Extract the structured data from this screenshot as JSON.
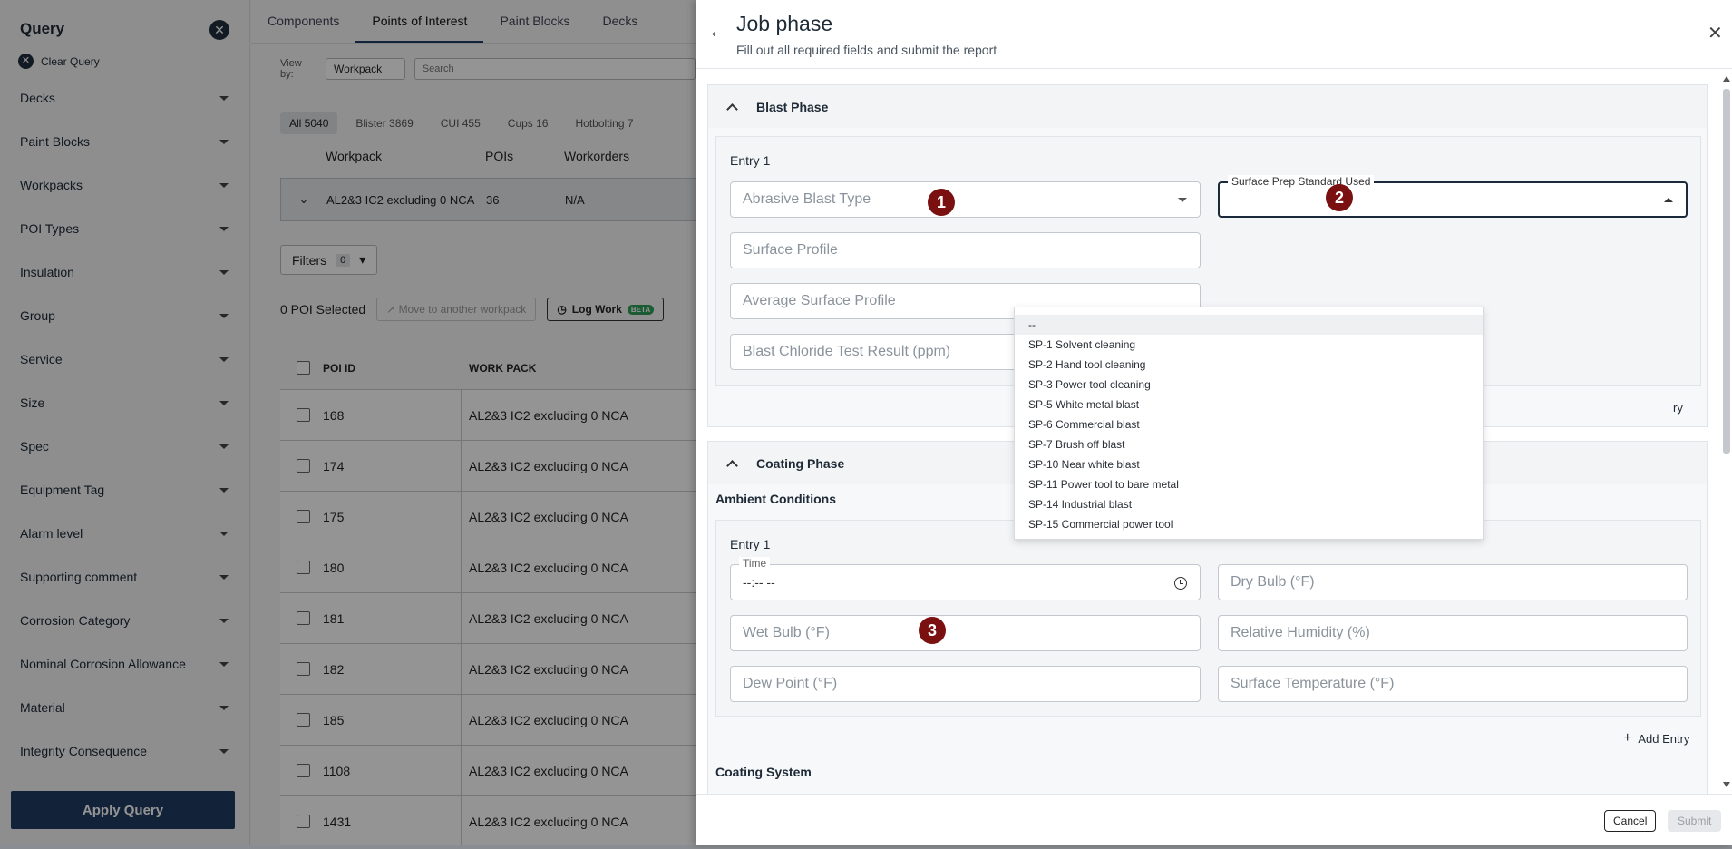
{
  "sidebar": {
    "title": "Query",
    "clear_label": "Clear Query",
    "filters": [
      "Decks",
      "Paint Blocks",
      "Workpacks",
      "POI Types",
      "Insulation",
      "Group",
      "Service",
      "Size",
      "Spec",
      "Equipment Tag",
      "Alarm level",
      "Supporting comment",
      "Corrosion Category",
      "Nominal Corrosion Allowance",
      "Material",
      "Integrity Consequence"
    ],
    "apply_label": "Apply Query"
  },
  "background": {
    "tabs": [
      "Components",
      "Points of Interest",
      "Paint Blocks",
      "Decks"
    ],
    "view_by_label": "View by:",
    "view_by_value": "Workpack",
    "search_placeholder": "Search",
    "chips": [
      "All 5040",
      "Blister 3869",
      "CUI 455",
      "Cups 16",
      "Hotbolting 7"
    ],
    "workpack_table": {
      "headers": [
        "Workpack",
        "POIs",
        "Workorders"
      ],
      "row": {
        "name": "AL2&3 IC2 excluding 0 NCA",
        "pois": "36",
        "workorders": "N/A"
      }
    },
    "filters_label": "Filters",
    "filters_count": "0",
    "selected_label": "0 POI Selected",
    "move_label": "Move to another workpack",
    "log_work_label": "Log Work",
    "beta_label": "BETA",
    "poi_table": {
      "headers": [
        "POI ID",
        "WORK PACK"
      ],
      "rows": [
        {
          "id": "168",
          "workpack": "AL2&3 IC2 excluding 0 NCA"
        },
        {
          "id": "174",
          "workpack": "AL2&3 IC2 excluding 0 NCA"
        },
        {
          "id": "175",
          "workpack": "AL2&3 IC2 excluding 0 NCA"
        },
        {
          "id": "180",
          "workpack": "AL2&3 IC2 excluding 0 NCA"
        },
        {
          "id": "181",
          "workpack": "AL2&3 IC2 excluding 0 NCA"
        },
        {
          "id": "182",
          "workpack": "AL2&3 IC2 excluding 0 NCA"
        },
        {
          "id": "185",
          "workpack": "AL2&3 IC2 excluding 0 NCA"
        },
        {
          "id": "1108",
          "workpack": "AL2&3 IC2 excluding 0 NCA"
        },
        {
          "id": "1431",
          "workpack": "AL2&3 IC2 excluding 0 NCA"
        }
      ]
    }
  },
  "drawer": {
    "title": "Job phase",
    "subtitle": "Fill out all required fields and submit the report",
    "blast": {
      "title": "Blast Phase",
      "entry_title": "Entry 1",
      "abrasive_placeholder": "Abrasive Blast Type",
      "surface_prep_label": "Surface Prep Standard Used",
      "surface_profile_placeholder": "Surface Profile",
      "avg_profile_placeholder": "Average Surface Profile",
      "chloride_placeholder": "Blast Chloride Test Result (ppm)",
      "add_entry_partial": "ry"
    },
    "surface_prep_options": [
      "--",
      "SP-1 Solvent cleaning",
      "SP-2 Hand tool cleaning",
      "SP-3 Power tool cleaning",
      "SP-5 White metal blast",
      "SP-6 Commercial blast",
      "SP-7 Brush off blast",
      "SP-10 Near white blast",
      "SP-11 Power tool to bare metal",
      "SP-14 Industrial blast",
      "SP-15 Commercial power tool"
    ],
    "coating": {
      "title": "Coating Phase",
      "ambient_title": "Ambient Conditions",
      "entry_title": "Entry 1",
      "time_label": "Time",
      "time_value": "--:-- --",
      "dry_bulb": "Dry Bulb (°F)",
      "wet_bulb": "Wet Bulb (°F)",
      "humidity": "Relative Humidity (%)",
      "dew_point": "Dew Point (°F)",
      "surface_temp": "Surface Temperature (°F)",
      "add_entry": "Add Entry",
      "coating_system_title": "Coating System"
    },
    "badges": [
      "1",
      "2",
      "3"
    ],
    "cancel_label": "Cancel",
    "submit_label": "Submit"
  }
}
